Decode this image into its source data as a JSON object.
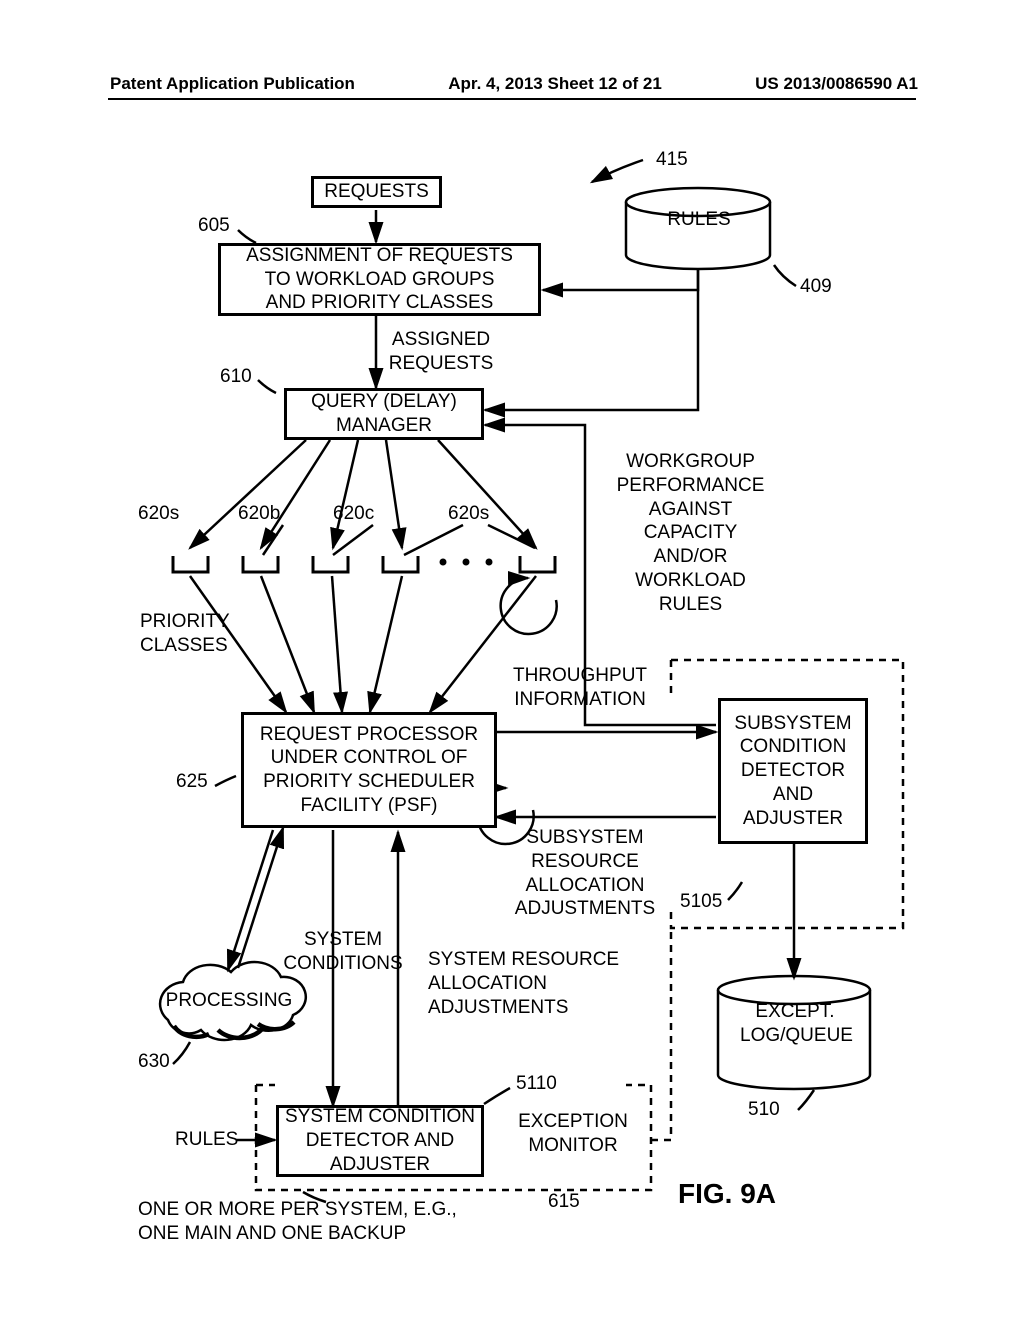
{
  "header": {
    "left": "Patent Application Publication",
    "mid": "Apr. 4, 2013  Sheet 12 of 21",
    "right": "US 2013/0086590 A1"
  },
  "boxes": {
    "requests": "REQUESTS",
    "rules": "RULES",
    "assignment": "ASSIGNMENT OF REQUESTS\nTO WORKLOAD GROUPS\nAND PRIORITY CLASSES",
    "assigned": "ASSIGNED\nREQUESTS",
    "query": "QUERY (DELAY)\nMANAGER",
    "rp": "REQUEST PROCESSOR\nUNDER CONTROL OF\nPRIORITY SCHEDULER\nFACILITY (PSF)",
    "scda": "SUBSYSTEM\nCONDITION\nDETECTOR\nAND\nADJUSTER",
    "except": "EXCEPT.\nLOG/QUEUE",
    "processing": "PROCESSING",
    "sysdet": "SYSTEM CONDITION\nDETECTOR AND\nADJUSTER",
    "exmon": "EXCEPTION\nMONITOR"
  },
  "labels": {
    "l415": "415",
    "l605": "605",
    "l409": "409",
    "l610": "610",
    "l620s": "620s",
    "l620b": "620b",
    "l620c": "620c",
    "l620s2": "620s",
    "priority": "PRIORITY\nCLASSES",
    "wgperf": "WORKGROUP\nPERFORMANCE\nAGAINST\nCAPACITY\nAND/OR\nWORKLOAD\nRULES",
    "throughput": "THROUGHPUT\nINFORMATION",
    "l625": "625",
    "sra": "SUBSYSTEM\nRESOURCE\nALLOCATION\nADJUSTMENTS",
    "l5105": "5105",
    "syscond": "SYSTEM\nCONDITIONS",
    "sysra": "SYSTEM RESOURCE\nALLOCATION\nADJUSTMENTS",
    "l630": "630",
    "l5110": "5110",
    "l510": "510",
    "rules2": "RULES",
    "footer": "ONE OR MORE PER SYSTEM, E.G.,\nONE MAIN AND ONE BACKUP",
    "l615": "615"
  },
  "figure": "FIG. 9A"
}
